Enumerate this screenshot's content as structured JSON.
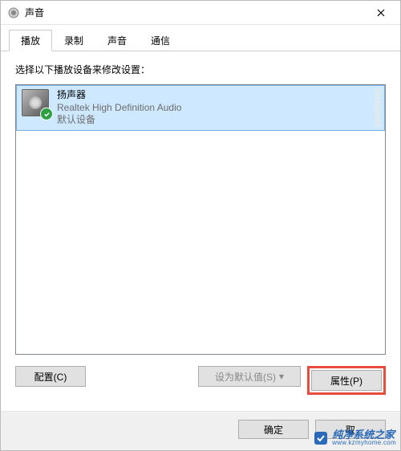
{
  "window": {
    "title": "声音"
  },
  "tabs": [
    {
      "label": "播放",
      "active": true
    },
    {
      "label": "录制",
      "active": false
    },
    {
      "label": "声音",
      "active": false
    },
    {
      "label": "通信",
      "active": false
    }
  ],
  "instruction": "选择以下播放设备来修改设置：",
  "device": {
    "name": "扬声器",
    "description": "Realtek High Definition Audio",
    "status": "默认设备"
  },
  "buttons": {
    "configure": "配置(C)",
    "set_default": "设为默认值(S)",
    "properties": "属性(P)"
  },
  "dialog_buttons": {
    "ok": "确定",
    "cancel": "取"
  },
  "watermark": {
    "main": "纯净系统之家",
    "sub": "www.kzmyhome.com"
  }
}
